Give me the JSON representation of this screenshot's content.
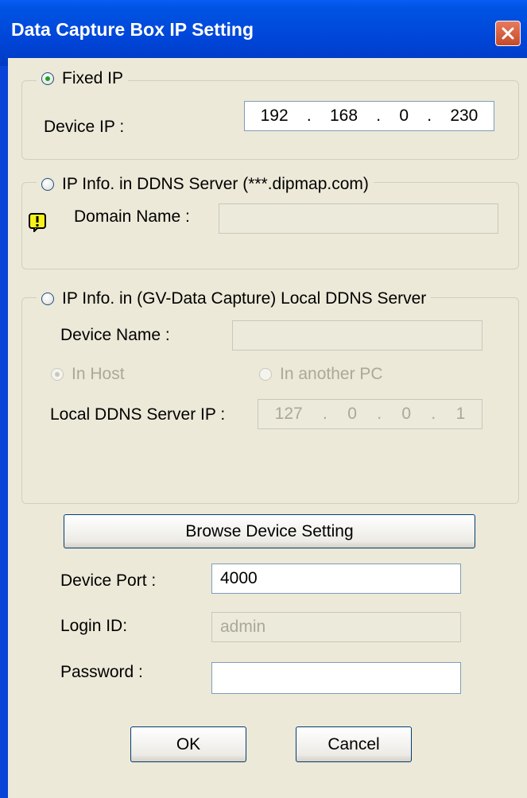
{
  "window": {
    "title": "Data Capture Box IP Setting"
  },
  "fixed_ip": {
    "label": "Fixed IP",
    "device_ip_label": "Device IP :",
    "ip": [
      "192",
      "168",
      "0",
      "230"
    ]
  },
  "ddns": {
    "label": "IP Info. in DDNS Server (***.dipmap.com)",
    "domain_label": "Domain Name :",
    "domain_value": ""
  },
  "local_ddns": {
    "label": "IP Info. in (GV-Data Capture) Local DDNS Server",
    "device_name_label": "Device Name :",
    "device_name_value": "",
    "in_host": "In Host",
    "in_another_pc": "In another PC",
    "server_ip_label": "Local DDNS Server IP :",
    "server_ip": [
      "127",
      "0",
      "0",
      "1"
    ]
  },
  "browse_button": "Browse Device Setting",
  "device_port": {
    "label": "Device Port :",
    "value": "4000"
  },
  "login_id": {
    "label": "Login ID:",
    "value": "admin"
  },
  "password": {
    "label": "Password :",
    "value": ""
  },
  "ok_button": "OK",
  "cancel_button": "Cancel",
  "icons": {
    "close": "close-icon",
    "warning": "warning-icon"
  }
}
